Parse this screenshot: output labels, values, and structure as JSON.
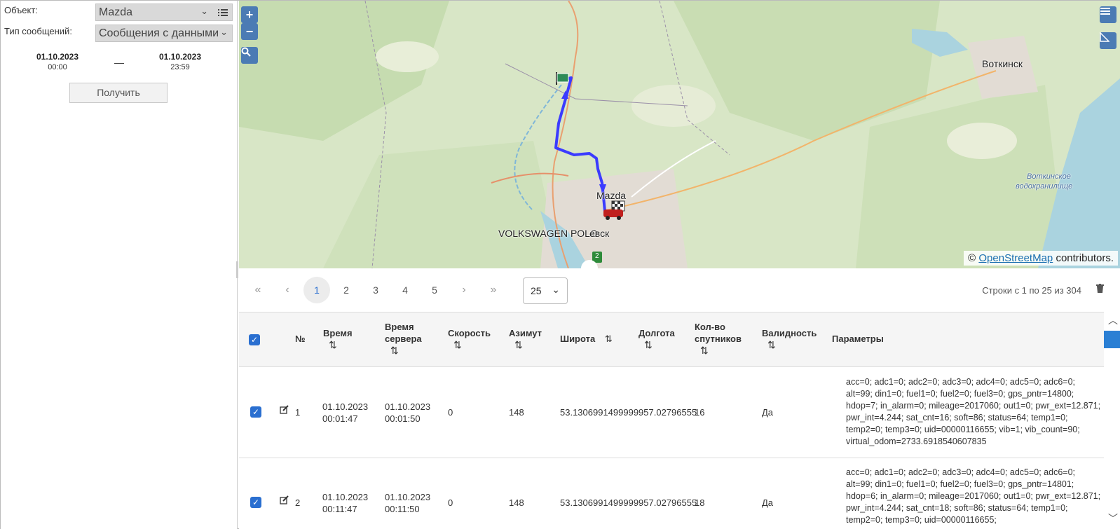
{
  "form": {
    "object_label": "Объект:",
    "object_value": "Mazda",
    "type_label": "Тип сообщений:",
    "type_value": "Сообщения с данными",
    "date_from": "01.10.2023",
    "time_from": "00:00",
    "date_to": "01.10.2023",
    "time_to": "23:59",
    "dash": "—",
    "get_button": "Получить"
  },
  "map": {
    "zoom_in": "+",
    "zoom_out": "−",
    "labels": {
      "votkinsk": "Воткинск",
      "reservoir1": "Воткинское",
      "reservoir2": "водохранилище",
      "mazda": "Mazda",
      "vw": "VOLKSWAGEN POLO",
      "city": "евск",
      "road": "2"
    },
    "attribution_prefix": "© ",
    "attribution_link": "OpenStreetMap",
    "attribution_suffix": " contributors."
  },
  "pager": {
    "first": "«",
    "prev": "‹",
    "pages": [
      "1",
      "2",
      "3",
      "4",
      "5"
    ],
    "active_page": "1",
    "next": "›",
    "last": "»",
    "page_size": "25",
    "rows_info": "Строки с 1 по 25 из 304"
  },
  "table": {
    "headers": {
      "num": "№",
      "time": "Время",
      "server_time_1": "Время",
      "server_time_2": "сервера",
      "speed": "Скорость",
      "azimuth": "Азимут",
      "lat": "Широта",
      "lon": "Долгота",
      "sats_1": "Кол-во",
      "sats_2": "спутников",
      "valid": "Валидность",
      "params": "Параметры",
      "sort_icon": "⇅"
    },
    "rows": [
      {
        "num": "1",
        "date": "01.10.2023",
        "time": "00:01:47",
        "server_date": "01.10.2023",
        "server_time": "00:01:50",
        "speed": "0",
        "azimuth": "148",
        "latlon": "53.1306991499999957.02796555",
        "sats": "16",
        "valid": "Да",
        "params": "acc=0; adc1=0; adc2=0; adc3=0; adc4=0; adc5=0; adc6=0; alt=99; din1=0; fuel1=0; fuel2=0; fuel3=0; gps_pntr=14800; hdop=7; in_alarm=0; mileage=2017060; out1=0; pwr_ext=12.871; pwr_int=4.244; sat_cnt=16; soft=86; status=64; temp1=0; temp2=0; temp3=0; uid=00000116655; vib=1; vib_count=90; virtual_odom=2733.6918540607835"
      },
      {
        "num": "2",
        "date": "01.10.2023",
        "time": "00:11:47",
        "server_date": "01.10.2023",
        "server_time": "00:11:50",
        "speed": "0",
        "azimuth": "148",
        "latlon": "53.1306991499999957.02796555",
        "sats": "18",
        "valid": "Да",
        "params": "acc=0; adc1=0; adc2=0; adc3=0; adc4=0; adc5=0; adc6=0; alt=99; din1=0; fuel1=0; fuel2=0; fuel3=0; gps_pntr=14801; hdop=6; in_alarm=0; mileage=2017060; out1=0; pwr_ext=12.871; pwr_int=4.244; sat_cnt=18; soft=86; status=64; temp1=0; temp2=0; temp3=0; uid=00000116655;"
      }
    ]
  },
  "colors": {
    "accent": "#2a6fd0",
    "track": "#3b3bff",
    "map_bg": "#d6e4c4",
    "water": "#aad3df"
  }
}
